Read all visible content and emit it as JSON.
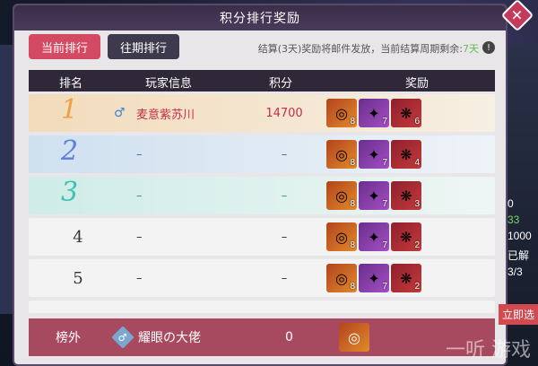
{
  "title": "积分排行奖励",
  "tabs": [
    "当前排行",
    "往期排行"
  ],
  "notice": "结算(3天)奖励将邮件发放，当前结算周期剩余:",
  "notice_value": "7天",
  "headers": [
    "排名",
    "玩家信息",
    "积分",
    "奖励"
  ],
  "rows": [
    {
      "rank": "1",
      "name": "麦意紫苏川",
      "score": "14700",
      "rewards": [
        "8",
        "7",
        "6"
      ]
    },
    {
      "rank": "2",
      "name": "–",
      "score": "–",
      "rewards": [
        "8",
        "7",
        "4"
      ]
    },
    {
      "rank": "3",
      "name": "–",
      "score": "–",
      "rewards": [
        "8",
        "7",
        "3"
      ]
    },
    {
      "rank": "4",
      "name": "–",
      "score": "–",
      "rewards": [
        "8",
        "7",
        "2"
      ]
    },
    {
      "rank": "5",
      "name": "–",
      "score": "–",
      "rewards": [
        "8",
        "7",
        "2"
      ]
    }
  ],
  "bottom": {
    "label": "榜外",
    "name": "耀眼の大佬",
    "score": "0"
  },
  "side_values": [
    "0",
    "33",
    "1000",
    "已解",
    "3/3"
  ],
  "select_label": "立即选",
  "watermark": "一听 游戏"
}
